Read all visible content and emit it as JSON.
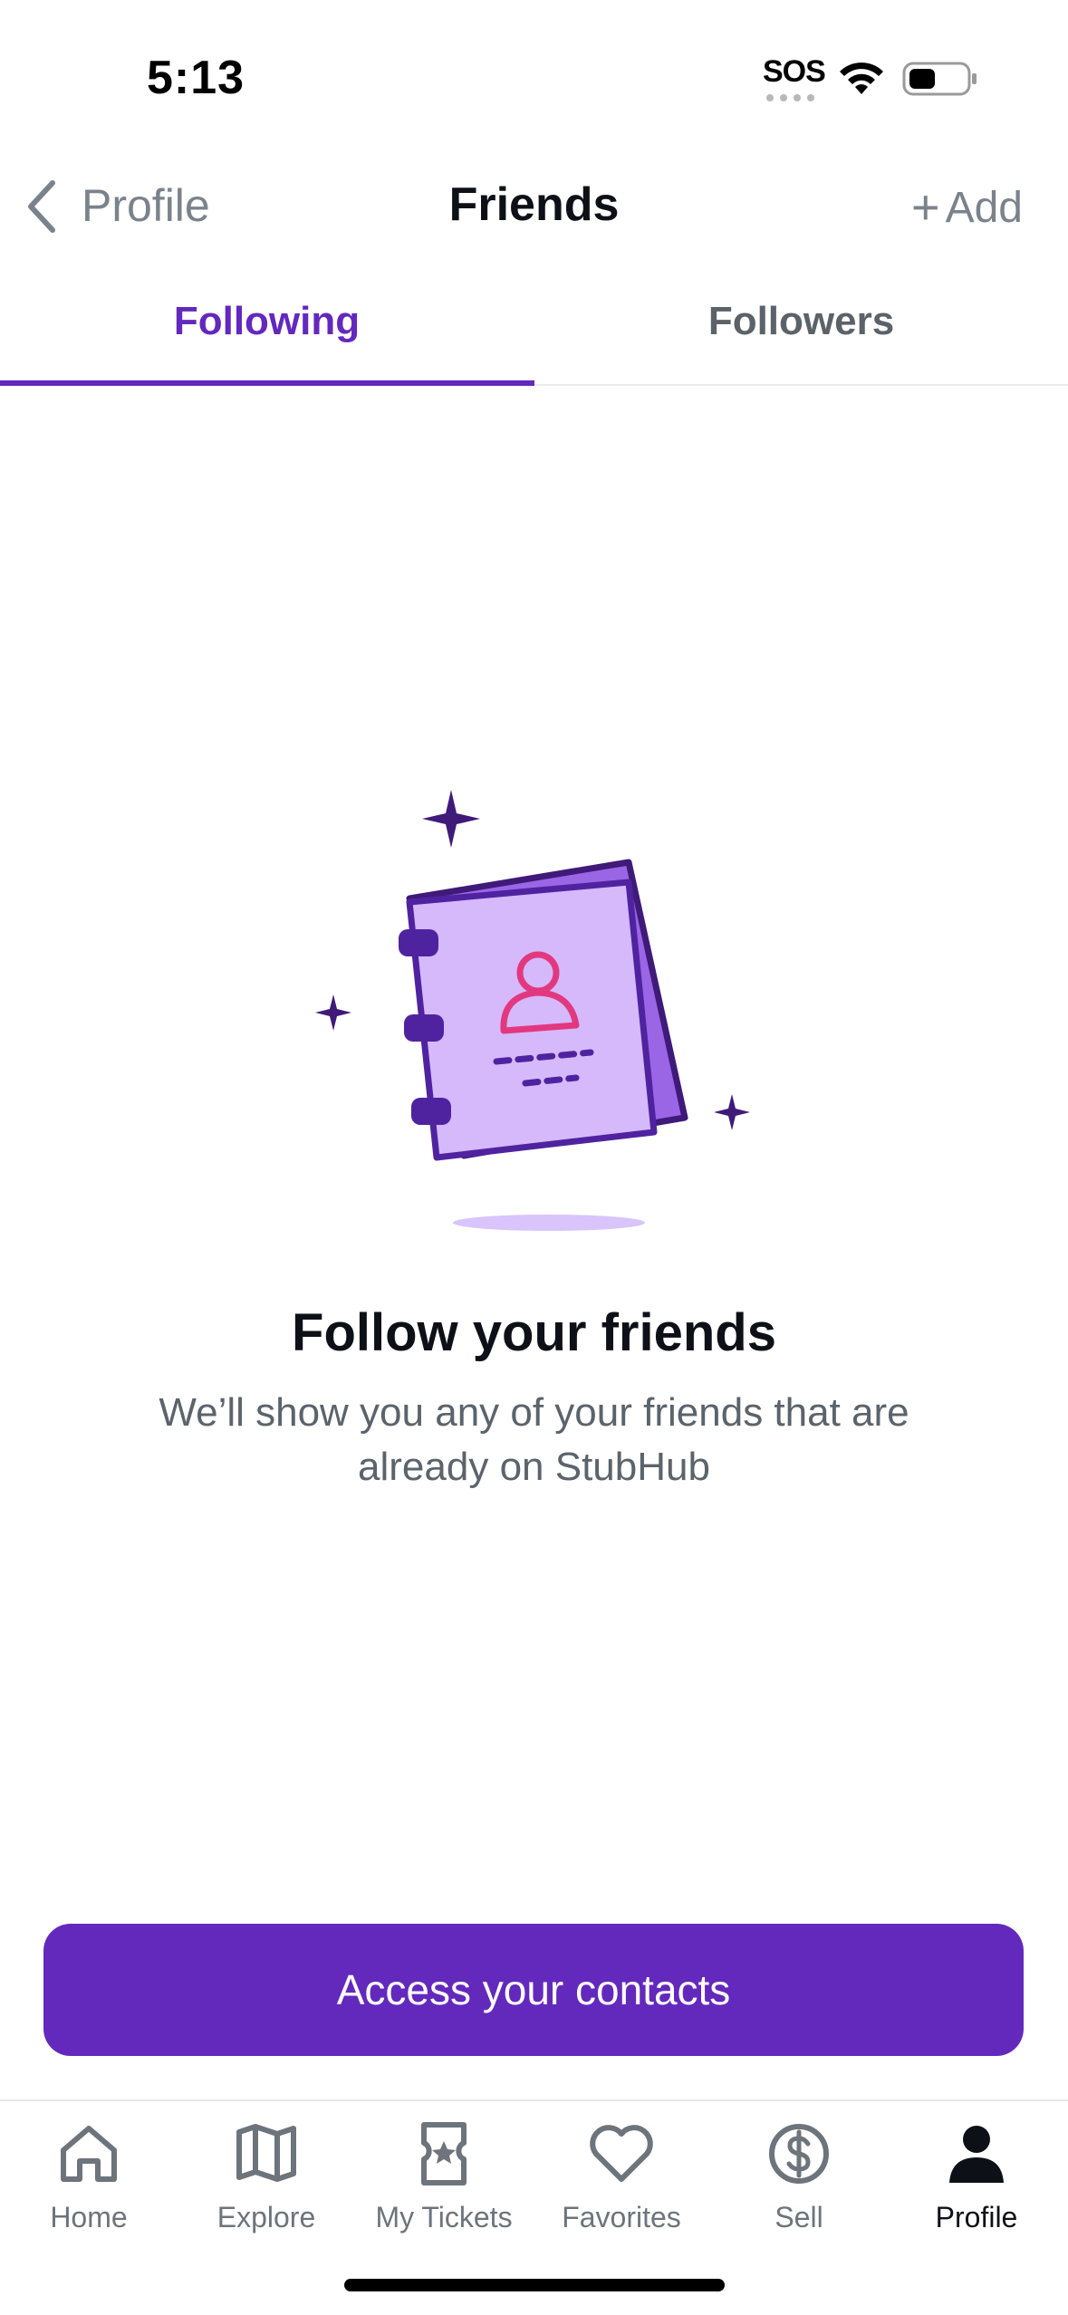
{
  "status_bar": {
    "time": "5:13",
    "sos": "SOS",
    "icons": [
      "wifi-icon",
      "battery-icon"
    ]
  },
  "nav": {
    "back_label": "Profile",
    "title": "Friends",
    "add_label": "Add",
    "add_icon": "+"
  },
  "tabs": {
    "following": "Following",
    "followers": "Followers",
    "active": "following"
  },
  "empty_state": {
    "title": "Follow your friends",
    "description": "We’ll show you any of your friends that are already on StubHub",
    "illustration": "address-book-illustration"
  },
  "cta": {
    "label": "Access your contacts"
  },
  "tab_bar": {
    "items": [
      {
        "label": "Home",
        "icon": "home-icon"
      },
      {
        "label": "Explore",
        "icon": "map-icon"
      },
      {
        "label": "My Tickets",
        "icon": "ticket-icon"
      },
      {
        "label": "Favorites",
        "icon": "heart-icon"
      },
      {
        "label": "Sell",
        "icon": "dollar-icon"
      },
      {
        "label": "Profile",
        "icon": "person-icon"
      }
    ],
    "active": "Profile"
  },
  "colors": {
    "accent": "#6328be",
    "cta_bg": "#6329bd",
    "muted_text": "#7a828b",
    "book_light": "#d5b9fb",
    "book_dark": "#4f23a0",
    "avatar_pink": "#e2387f"
  }
}
